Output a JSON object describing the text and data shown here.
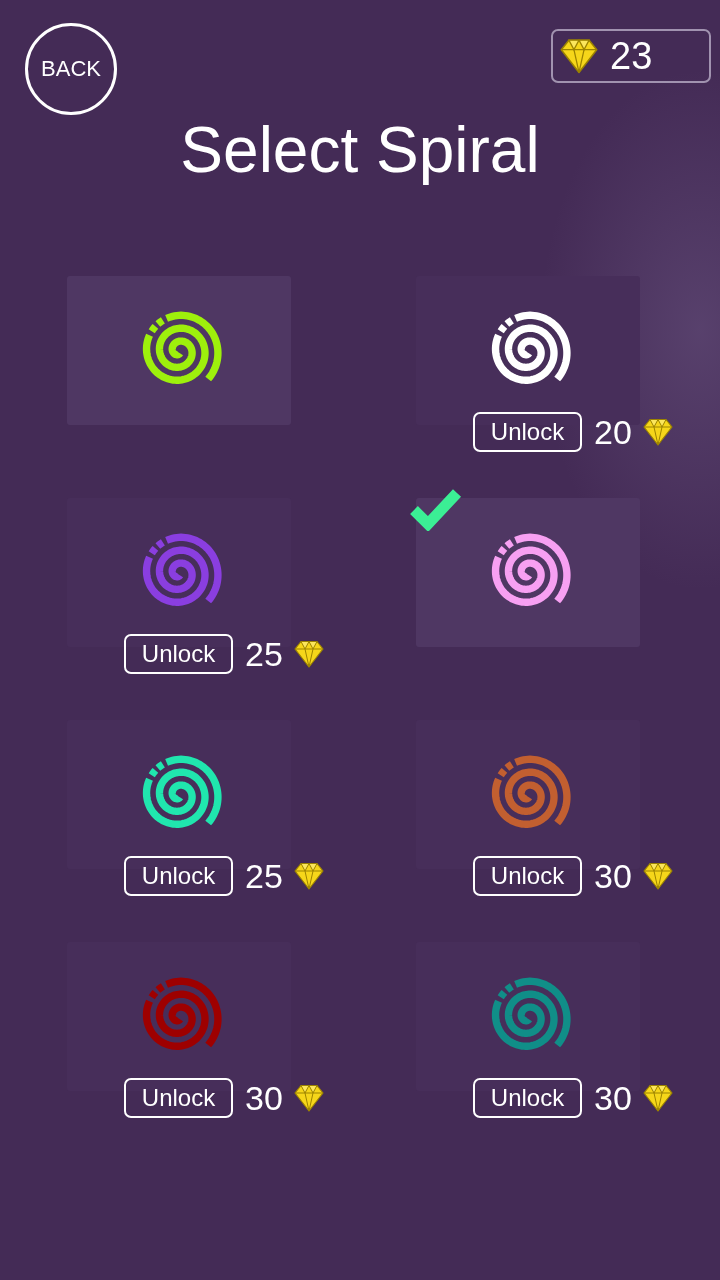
{
  "header": {
    "back_button": "BACK",
    "gems": "23"
  },
  "title": "Select Spiral",
  "spirals": [
    {
      "color": "#9ef00c",
      "locked": false,
      "selected": false
    },
    {
      "color": "#ffffff",
      "locked": true,
      "selected": false,
      "unlock_label": "Unlock",
      "price": "20"
    },
    {
      "color": "#8a3ee0",
      "locked": true,
      "selected": false,
      "unlock_label": "Unlock",
      "price": "25"
    },
    {
      "color": "#f7a0f2",
      "locked": false,
      "selected": true
    },
    {
      "color": "#20e6ae",
      "locked": true,
      "selected": false,
      "unlock_label": "Unlock",
      "price": "25"
    },
    {
      "color": "#c25f30",
      "locked": true,
      "selected": false,
      "unlock_label": "Unlock",
      "price": "30"
    },
    {
      "color": "#9e0000",
      "locked": true,
      "selected": false,
      "unlock_label": "Unlock",
      "price": "30"
    },
    {
      "color": "#108e88",
      "locked": true,
      "selected": false,
      "unlock_label": "Unlock",
      "price": "30"
    }
  ]
}
